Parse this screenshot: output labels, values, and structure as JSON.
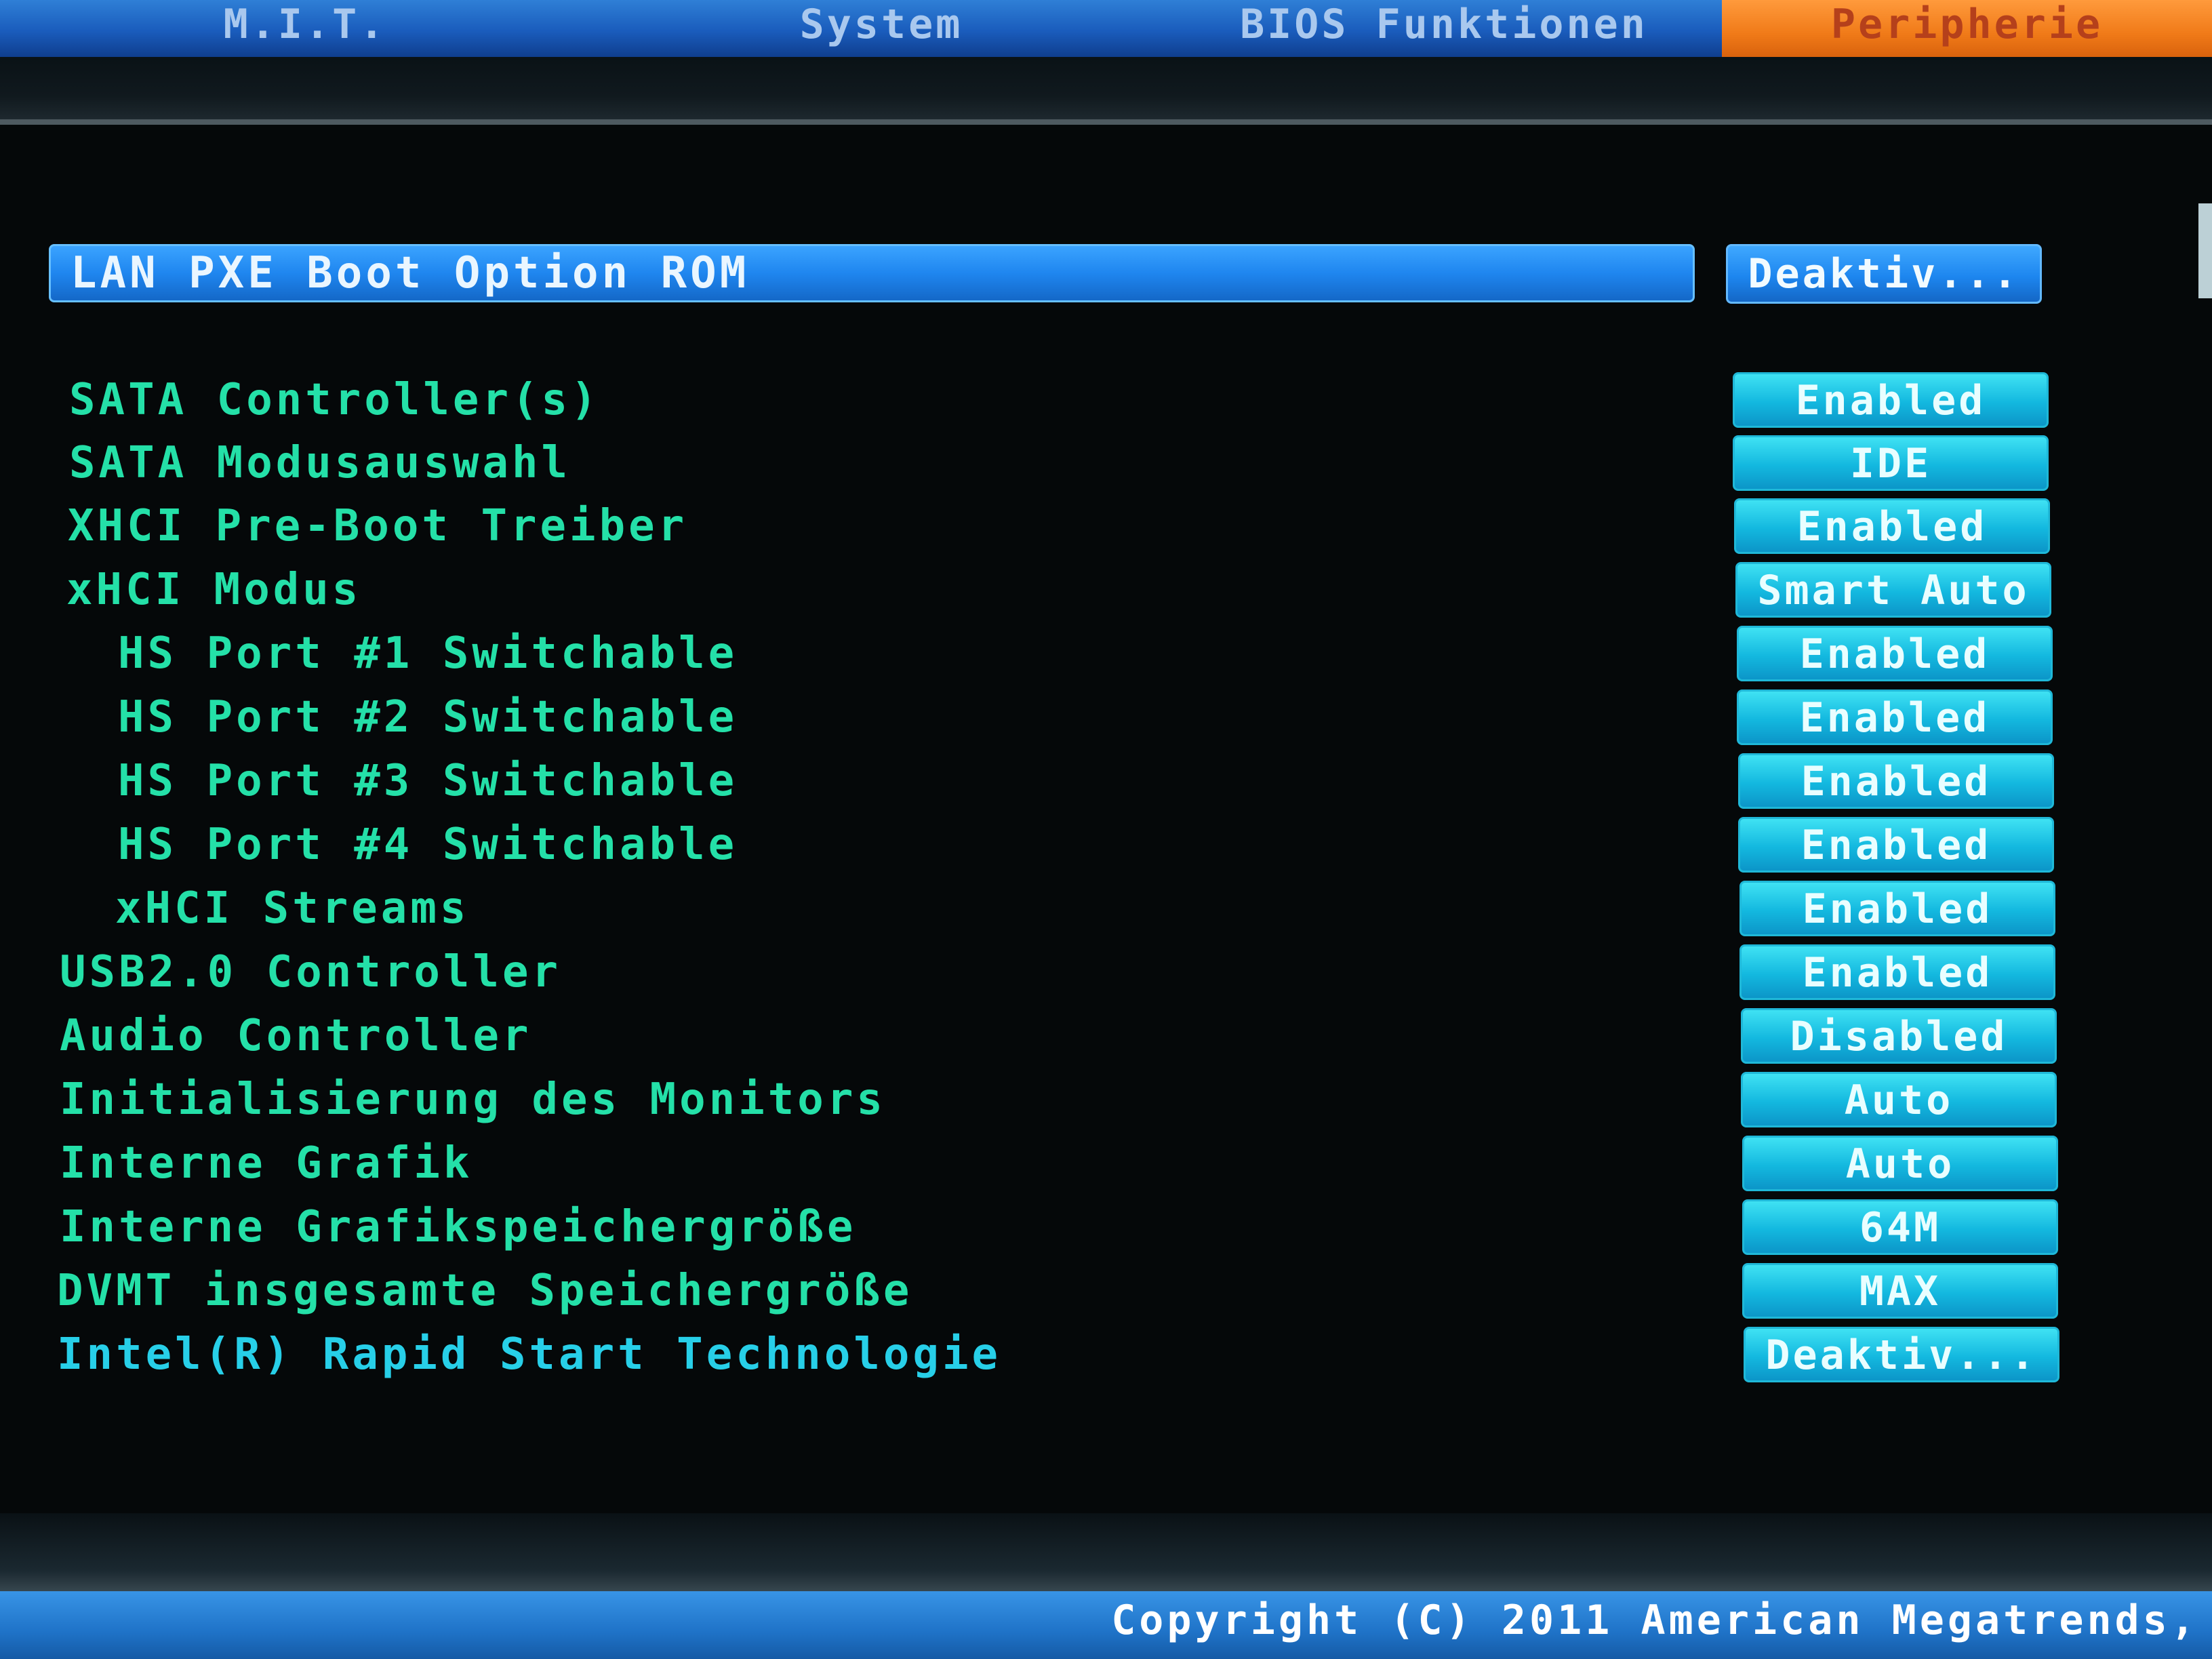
{
  "tabs": [
    {
      "label": "M.I.T."
    },
    {
      "label": "System"
    },
    {
      "label": "BIOS Funktionen"
    },
    {
      "label": "Peripherie"
    }
  ],
  "selected": {
    "label": "LAN PXE Boot Option ROM",
    "value": "Deaktiv..."
  },
  "options": [
    {
      "label": "SATA Controller(s)",
      "value": "Enabled"
    },
    {
      "label": "SATA Modusauswahl",
      "value": "IDE"
    },
    {
      "label": "XHCI Pre-Boot Treiber",
      "value": "Enabled"
    },
    {
      "label": "xHCI Modus",
      "value": "Smart Auto"
    },
    {
      "label": "HS Port #1 Switchable",
      "value": "Enabled"
    },
    {
      "label": "HS Port #2 Switchable",
      "value": "Enabled"
    },
    {
      "label": "HS Port #3 Switchable",
      "value": "Enabled"
    },
    {
      "label": "HS Port #4 Switchable",
      "value": "Enabled"
    },
    {
      "label": "xHCI Streams",
      "value": "Enabled"
    },
    {
      "label": "USB2.0 Controller",
      "value": "Enabled"
    },
    {
      "label": "Audio Controller",
      "value": "Disabled"
    },
    {
      "label": "Initialisierung des Monitors",
      "value": "Auto"
    },
    {
      "label": "Interne Grafik",
      "value": "Auto"
    },
    {
      "label": "Interne Grafikspeichergröße",
      "value": "64M"
    },
    {
      "label": "DVMT insgesamte Speichergröße",
      "value": "MAX"
    },
    {
      "label": "Intel(R) Rapid Start Technologie",
      "value": "Deaktiv..."
    }
  ],
  "footer": {
    "copyright": "Copyright (C) 2011 American Megatrends,"
  },
  "colors": {
    "tab_bar": "#1a5cbc",
    "active_tab": "#f07a18",
    "selected_row": "#1f86ef",
    "label_green": "#24e0a8",
    "label_cyan": "#27cfe8",
    "value_box": "#13b8df"
  }
}
